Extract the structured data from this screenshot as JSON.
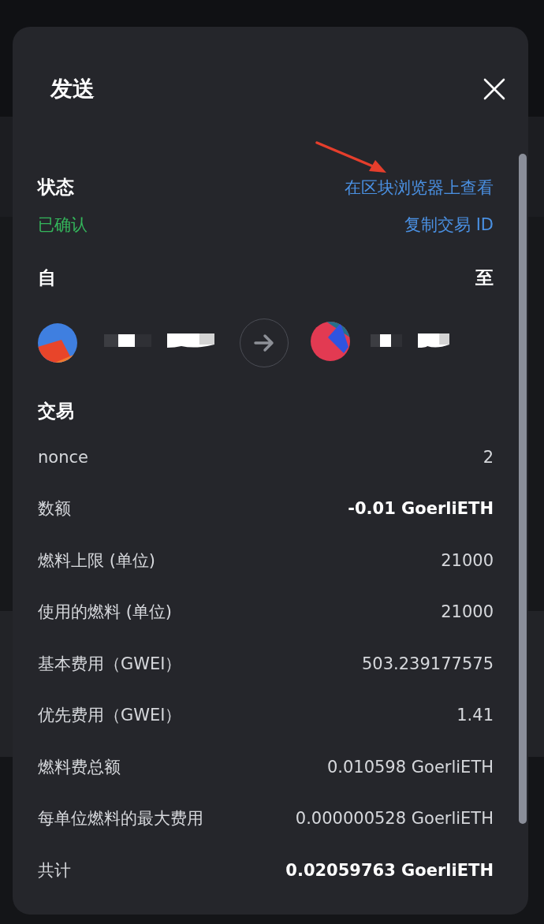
{
  "dialog": {
    "title": "发送"
  },
  "status": {
    "label": "状态",
    "value": "已确认",
    "links": [
      "在区块浏览器上查看",
      "复制交易 ID"
    ]
  },
  "parties": {
    "from_label": "自",
    "to_label": "至"
  },
  "transaction": {
    "heading": "交易",
    "rows": [
      {
        "label": "nonce",
        "value": "2",
        "emphasized": false
      },
      {
        "label": "数额",
        "value": "-0.01 GoerliETH",
        "emphasized": true
      },
      {
        "label": "燃料上限 (单位)",
        "value": "21000",
        "emphasized": false
      },
      {
        "label": "使用的燃料 (单位)",
        "value": "21000",
        "emphasized": false
      },
      {
        "label": "基本费用（GWEI）",
        "value": "503.239177575",
        "emphasized": false
      },
      {
        "label": "优先费用（GWEI）",
        "value": "1.41",
        "emphasized": false
      },
      {
        "label": "燃料费总额",
        "value": "0.010598 GoerliETH",
        "emphasized": false
      },
      {
        "label": "每单位燃料的最大费用",
        "value": "0.000000528 GoerliETH",
        "emphasized": false
      },
      {
        "label": "共计",
        "value": "0.02059763 GoerliETH",
        "emphasized": true
      }
    ]
  }
}
